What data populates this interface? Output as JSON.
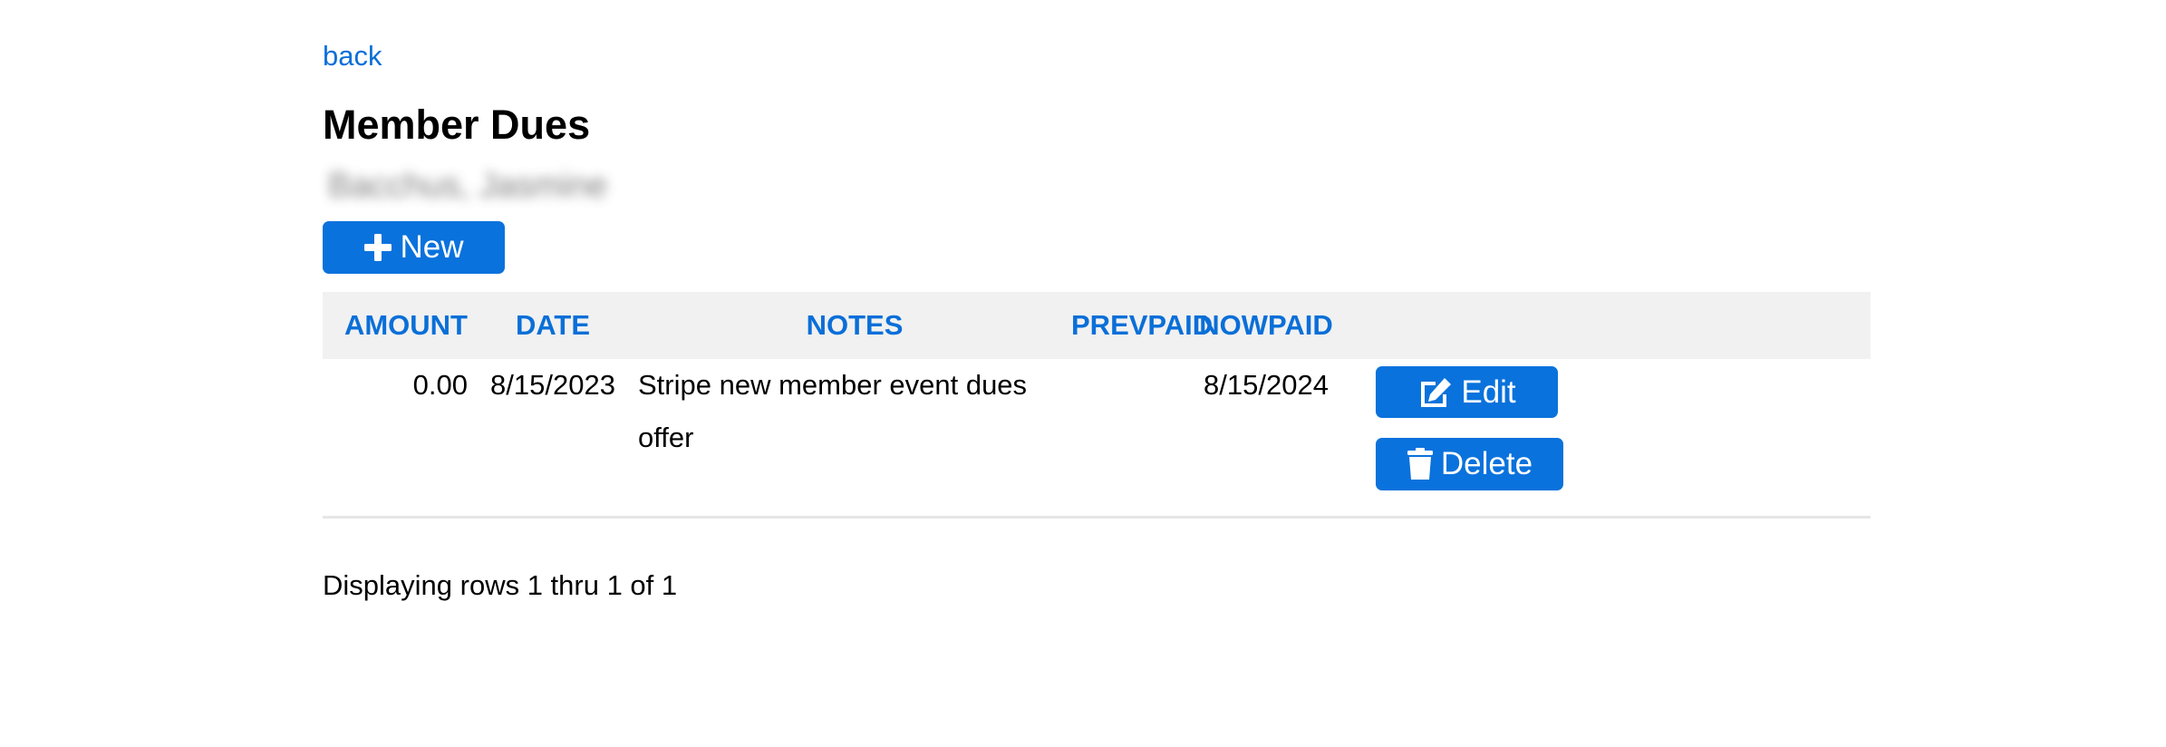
{
  "nav": {
    "back_label": "back"
  },
  "page": {
    "title": "Member Dues",
    "member_name": "Bacchus, Jasmine"
  },
  "toolbar": {
    "new_label": "New",
    "new_icon": "plus-icon"
  },
  "table": {
    "columns": [
      "AMOUNT",
      "DATE",
      "NOTES",
      "PREVPAID",
      "NOWPAID",
      ""
    ],
    "rows": [
      {
        "amount": "0.00",
        "date": "8/15/2023",
        "notes": "Stripe new member event dues offer",
        "prevpaid": "",
        "nowpaid": "8/15/2024",
        "edit_label": "Edit",
        "delete_label": "Delete"
      }
    ]
  },
  "footer": {
    "status": "Displaying rows 1 thru 1 of 1"
  },
  "colors": {
    "accent": "#0a72dc",
    "link": "#0a6fd8",
    "header_bg": "#f1f1f1"
  }
}
